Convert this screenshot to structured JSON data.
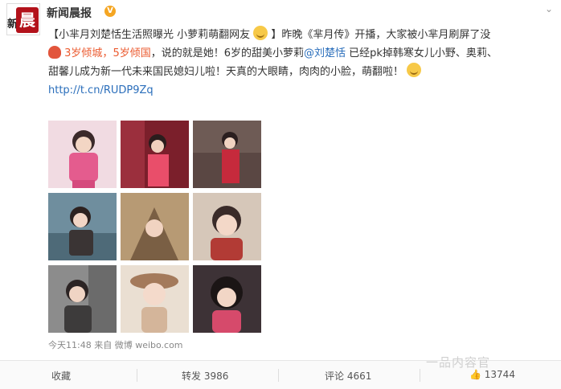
{
  "header": {
    "account_name": "新闻晨报",
    "verified_badge": "V",
    "avatar_text_large": "晨",
    "avatar_text_small": "新",
    "menu_icon": "chevron-down-icon"
  },
  "post": {
    "line1_prefix": "【小芈月刘楚恬生活照曝光 小萝莉萌翻网友",
    "line1_suffix": "】昨晚《芈月传》开播，大家被小芈月刷屏了没",
    "line2_hl1": "3岁倾城",
    "line2_sep": "，",
    "line2_hl2": "5岁倾国",
    "line2_text": "，说的就是她！6岁的甜美小萝莉",
    "mention": "@刘楚恬",
    "line2_tail": " 已经pk掉韩寒女儿小野、奥莉、",
    "line3": "甜馨儿成为新一代未来国民媳妇儿啦！天真的大眼睛，肉肉的小脸，萌翻啦！",
    "link": "http://t.cn/RUDP9Zq"
  },
  "photos": [
    {
      "label": "photo-1",
      "bg": "#e7b8c6"
    },
    {
      "label": "photo-2",
      "bg": "#8a2a35"
    },
    {
      "label": "photo-3",
      "bg": "#4e3a36"
    },
    {
      "label": "photo-4",
      "bg": "#5e7c8e"
    },
    {
      "label": "photo-5",
      "bg": "#a9885f"
    },
    {
      "label": "photo-6",
      "bg": "#c7b7a8"
    },
    {
      "label": "photo-7",
      "bg": "#7b7b7b"
    },
    {
      "label": "photo-8",
      "bg": "#e1d2c0"
    },
    {
      "label": "photo-9",
      "bg": "#3e3339"
    }
  ],
  "meta": {
    "time": "今天11:48",
    "source": "来自 微博 weibo.com"
  },
  "footer": {
    "favorite": "收藏",
    "repost": "转发 3986",
    "comment": "评论 4661",
    "like_count": "13744"
  },
  "watermark": "一品内容官"
}
